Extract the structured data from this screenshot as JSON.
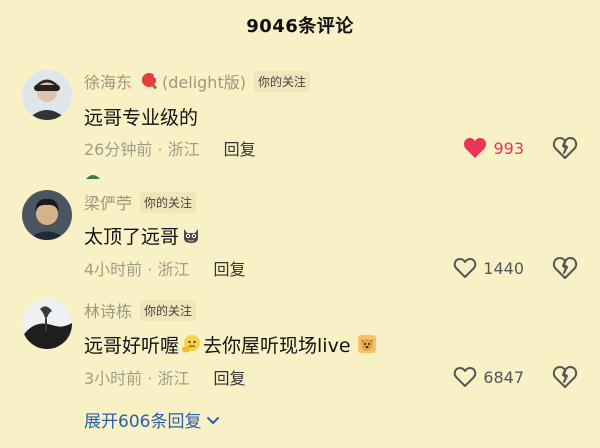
{
  "header": {
    "title": "9046条评论"
  },
  "comments": [
    {
      "username": "徐海东",
      "username_suffix": "(delight版)",
      "badge": "你的关注",
      "text": "远哥专业级的",
      "emoji": "",
      "text_after": "",
      "time": "26分钟前 · 浙江",
      "reply": "回复",
      "likes": "993",
      "liked": true
    },
    {
      "username": "梁俨苧",
      "username_suffix": "",
      "badge": "你的关注",
      "text": "太顶了远哥",
      "emoji": "cat-face-emoji",
      "text_after": "",
      "time": "4小时前 · 浙江",
      "reply": "回复",
      "likes": "1440",
      "liked": false
    },
    {
      "username": "林诗栋",
      "username_suffix": "",
      "badge": "你的关注",
      "text": "远哥好听喔",
      "emoji": "thinking-face-emoji",
      "text_after": "去你屋听现场live",
      "time": "3小时前 · 浙江",
      "reply": "回复",
      "likes": "6847",
      "liked": false
    }
  ],
  "expand": {
    "label": "展开606条回复"
  },
  "colors": {
    "background": "#f9f1c6",
    "liked": "#e8365a",
    "link": "#2c5fa8",
    "muted": "#a19d8b"
  }
}
